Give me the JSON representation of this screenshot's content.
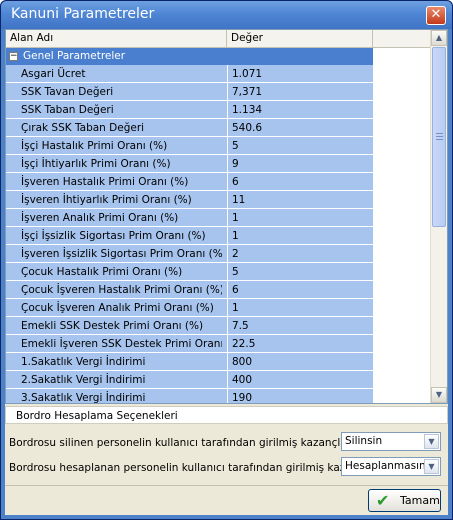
{
  "window": {
    "title": "Kanuni Parametreler"
  },
  "grid": {
    "columns": [
      "Alan Adı",
      "Değer"
    ],
    "group": "Genel Parametreler",
    "rows": [
      {
        "name": "Asgari Ücret",
        "value": "1.071"
      },
      {
        "name": "SSK Tavan Değeri",
        "value": "7,371"
      },
      {
        "name": "SSK Taban Değeri",
        "value": "1.134"
      },
      {
        "name": "Çırak SSK Taban Değeri",
        "value": "540.6"
      },
      {
        "name": "İşçi Hastalık Primi Oranı (%)",
        "value": "5"
      },
      {
        "name": "İşçi İhtiyarlık Primi Oranı (%)",
        "value": "9"
      },
      {
        "name": "İşveren Hastalık Primi Oranı (%)",
        "value": "6"
      },
      {
        "name": "İşveren İhtiyarlık Primi Oranı (%)",
        "value": "11"
      },
      {
        "name": "İşveren Analık Primi  Oranı (%)",
        "value": "1"
      },
      {
        "name": "İşçi İşsizlik Sigortası Prim Oranı (%)",
        "value": "1"
      },
      {
        "name": "İşveren İşsizlik Sigortası Prim Oranı (%)",
        "value": "2"
      },
      {
        "name": "Çocuk Hastalık Primi Oranı (%)",
        "value": "5"
      },
      {
        "name": "Çocuk İşveren Hastalık Primi Oranı (%)",
        "value": "6"
      },
      {
        "name": "Çocuk İşveren Analık Primi  Oranı (%)",
        "value": "1"
      },
      {
        "name": "Emekli SSK Destek Primi Oranı (%)",
        "value": "7.5"
      },
      {
        "name": "Emekli İşveren SSK Destek Primi Oranı (%",
        "value": "22.5"
      },
      {
        "name": "1.Sakatlık Vergi İndirimi",
        "value": "800"
      },
      {
        "name": "2.Sakatlık Vergi İndirimi",
        "value": "400"
      },
      {
        "name": "3.Sakatlık Vergi İndirimi",
        "value": "190"
      }
    ]
  },
  "bordro": {
    "title": "Bordro Hesaplama Seçenekleri",
    "options": [
      {
        "label": "Bordrosu silinen personelin kullanıcı tarafından girilmiş kazançları",
        "value": "Silinsin"
      },
      {
        "label": "Bordrosu hesaplanan personelin kullanıcı tarafından girilmiş kazançları",
        "value": "Hesaplanmasın"
      }
    ]
  },
  "buttons": {
    "ok": "Tamam"
  },
  "icons": {
    "close": "close-icon",
    "expander": "minus-icon",
    "scroll_up": "arrow-up-icon",
    "scroll_down": "arrow-down-icon",
    "dropdown": "chevron-down-icon",
    "ok": "checkmark-icon"
  },
  "colors": {
    "title_bar": "#4f86d4",
    "group_row": "#4a7fd0",
    "data_row": "#a6c4ee",
    "dialog_bg": "#ece9d8"
  }
}
